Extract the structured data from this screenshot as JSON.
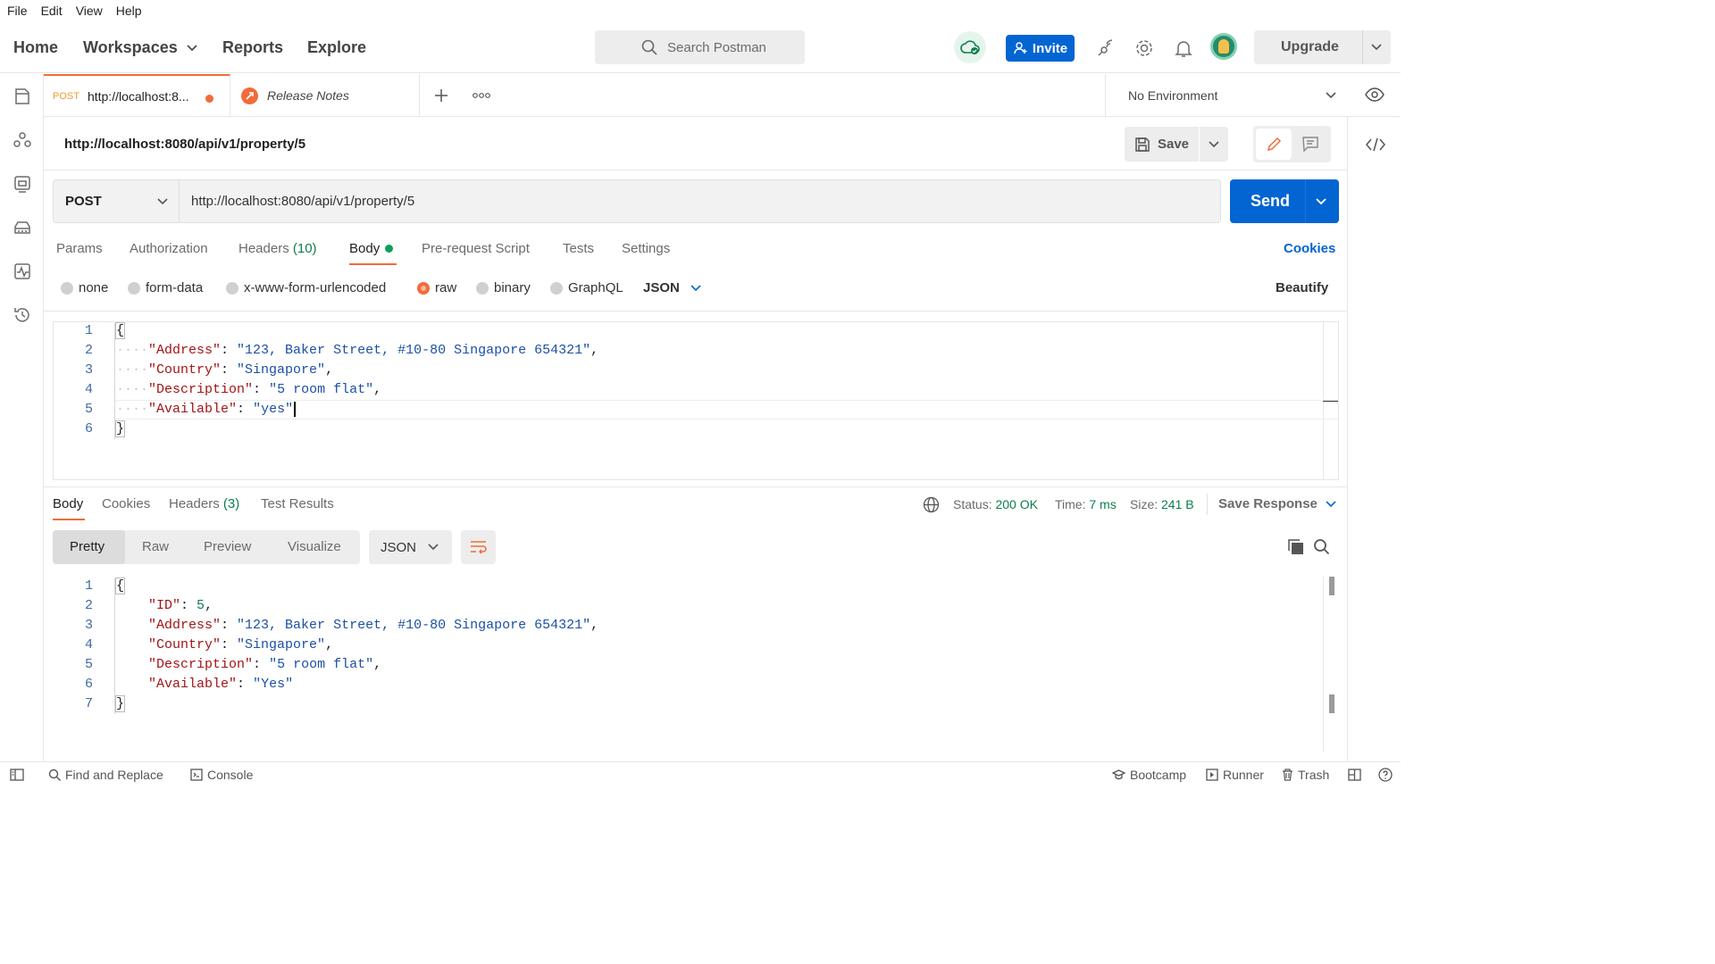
{
  "menubar": {
    "items": [
      "File",
      "Edit",
      "View",
      "Help"
    ]
  },
  "header": {
    "nav": {
      "home": "Home",
      "workspaces": "Workspaces",
      "reports": "Reports",
      "explore": "Explore"
    },
    "search_placeholder": "Search Postman",
    "invite_label": "Invite",
    "upgrade_label": "Upgrade"
  },
  "tabs": [
    {
      "method": "POST",
      "title": "http://localhost:8...",
      "unsaved": true
    },
    {
      "title": "Release Notes"
    }
  ],
  "environment": {
    "selected": "No Environment"
  },
  "request": {
    "name": "http://localhost:8080/api/v1/property/5",
    "save_label": "Save",
    "method": "POST",
    "url": "http://localhost:8080/api/v1/property/5",
    "send_label": "Send",
    "tabs": {
      "params": "Params",
      "authorization": "Authorization",
      "headers": "Headers",
      "headers_count": "(10)",
      "body": "Body",
      "prerequest": "Pre-request Script",
      "tests": "Tests",
      "settings": "Settings"
    },
    "cookies_label": "Cookies",
    "body_types": [
      "none",
      "form-data",
      "x-www-form-urlencoded",
      "raw",
      "binary",
      "GraphQL"
    ],
    "selected_body_type": "raw",
    "format": "JSON",
    "beautify_label": "Beautify",
    "line_numbers": [
      "1",
      "2",
      "3",
      "4",
      "5",
      "6"
    ],
    "body_lines": {
      "l1": "{",
      "l2_key": "\"Address\"",
      "l2_val": "\"123, Baker Street, #10-80 Singapore 654321\"",
      "l3_key": "\"Country\"",
      "l3_val": "\"Singapore\"",
      "l4_key": "\"Description\"",
      "l4_val": "\"5 room flat\"",
      "l5_key": "\"Available\"",
      "l5_val": "\"yes\"",
      "l6": "}"
    }
  },
  "response": {
    "tabs": {
      "body": "Body",
      "cookies": "Cookies",
      "headers": "Headers",
      "headers_count": "(3)",
      "test_results": "Test Results"
    },
    "status_label": "Status:",
    "status_value": "200 OK",
    "time_label": "Time:",
    "time_value": "7 ms",
    "size_label": "Size:",
    "size_value": "241 B",
    "save_response_label": "Save Response",
    "view_modes": [
      "Pretty",
      "Raw",
      "Preview",
      "Visualize"
    ],
    "format": "JSON",
    "line_numbers": [
      "1",
      "2",
      "3",
      "4",
      "5",
      "6",
      "7"
    ],
    "body_lines": {
      "l1": "{",
      "l2_key": "\"ID\"",
      "l2_val": "5",
      "l3_key": "\"Address\"",
      "l3_val": "\"123, Baker Street, #10-80 Singapore 654321\"",
      "l4_key": "\"Country\"",
      "l4_val": "\"Singapore\"",
      "l5_key": "\"Description\"",
      "l5_val": "\"5 room flat\"",
      "l6_key": "\"Available\"",
      "l6_val": "\"Yes\"",
      "l7": "}"
    }
  },
  "footer": {
    "find_replace": "Find and Replace",
    "console": "Console",
    "bootcamp": "Bootcamp",
    "runner": "Runner",
    "trash": "Trash"
  },
  "colors": {
    "accent_blue": "#0265d2",
    "accent_orange": "#f26b3a",
    "status_green": "#0d7d4d"
  }
}
